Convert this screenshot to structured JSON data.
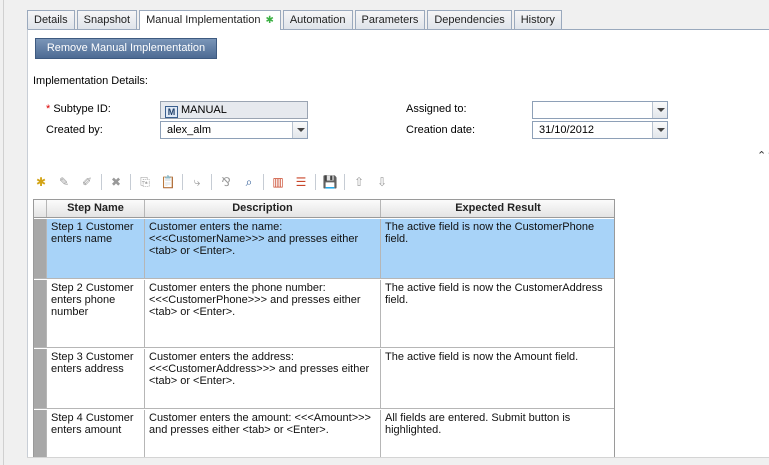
{
  "tabs": [
    {
      "label": "Details",
      "active": false
    },
    {
      "label": "Snapshot",
      "active": false
    },
    {
      "label": "Manual Implementation",
      "active": true,
      "modified_mark": "✱"
    },
    {
      "label": "Automation",
      "active": false
    },
    {
      "label": "Parameters",
      "active": false
    },
    {
      "label": "Dependencies",
      "active": false
    },
    {
      "label": "History",
      "active": false
    }
  ],
  "remove_button_label": "Remove Manual Implementation",
  "details": {
    "section_title": "Implementation Details:",
    "subtype_required_mark": "*",
    "subtype_label": "Subtype ID:",
    "subtype_value": "MANUAL",
    "subtype_icon_glyph": "M",
    "created_by_label": "Created by:",
    "created_by_value": "alex_alm",
    "assigned_to_label": "Assigned to:",
    "assigned_to_value": "",
    "creation_date_label": "Creation date:",
    "creation_date_value": "31/10/2012",
    "collapse_glyph": "⌃⌃"
  },
  "toolbar": [
    {
      "name": "new-step-icon",
      "glyph": "✱",
      "enabled": true
    },
    {
      "name": "edit-step-icon",
      "glyph": "✎",
      "enabled": false
    },
    {
      "name": "edit-all-icon",
      "glyph": "✐",
      "enabled": false
    },
    {
      "name": "delete-step-icon",
      "glyph": "✖",
      "enabled": false
    },
    {
      "name": "copy-icon",
      "glyph": "⎘",
      "enabled": false
    },
    {
      "name": "paste-icon",
      "glyph": "📋",
      "enabled": false
    },
    {
      "name": "call-test-icon",
      "glyph": "⤷",
      "enabled": false
    },
    {
      "name": "parameter-icon",
      "glyph": "⅋",
      "enabled": false
    },
    {
      "name": "find-icon",
      "glyph": "⌕",
      "enabled": true
    },
    {
      "name": "columns-icon",
      "glyph": "▥",
      "enabled": true
    },
    {
      "name": "renumber-icon",
      "glyph": "☰",
      "enabled": true
    },
    {
      "name": "save-icon",
      "glyph": "💾",
      "enabled": true
    },
    {
      "name": "move-up-icon",
      "glyph": "⇧",
      "enabled": false
    },
    {
      "name": "move-down-icon",
      "glyph": "⇩",
      "enabled": false
    }
  ],
  "grid": {
    "columns": [
      "Step Name",
      "Description",
      "Expected Result"
    ],
    "rows": [
      {
        "step": "Step 1 Customer enters name",
        "description": "Customer enters the name: <<<CustomerName>>> and presses either <tab> or <Enter>.",
        "expected": "The active field is now the CustomerPhone field.",
        "selected": true
      },
      {
        "step": "Step 2 Customer enters phone number",
        "description": "Customer enters the phone number: <<<CustomerPhone>>> and presses either <tab> or <Enter>.",
        "expected": "The active field is now the CustomerAddress field.",
        "selected": false
      },
      {
        "step": "Step 3 Customer enters address",
        "description": "Customer enters the address: <<<CustomerAddress>>> and presses either <tab> or <Enter>.",
        "expected": " The active field is now the Amount field.",
        "selected": false
      },
      {
        "step": "Step 4 Customer enters amount",
        "description": "Customer enters the amount: <<<Amount>>> and presses either <tab> or <Enter>.",
        "expected": "All fields are entered. Submit button is highlighted.",
        "selected": false
      }
    ]
  }
}
